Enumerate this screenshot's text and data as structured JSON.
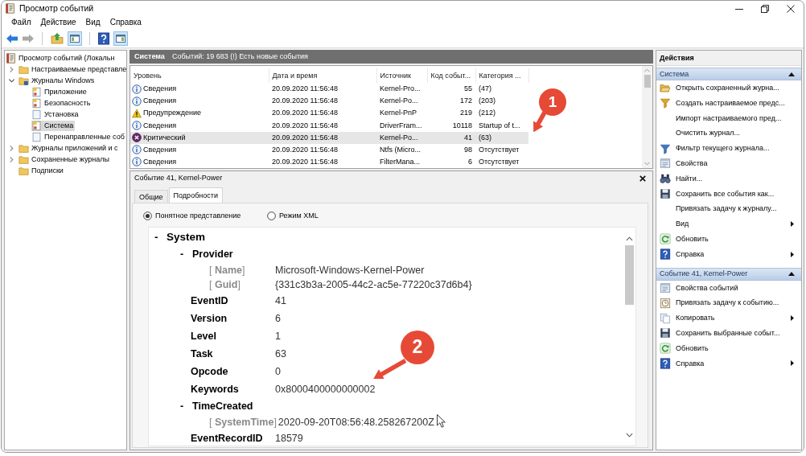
{
  "window": {
    "title": "Просмотр событий"
  },
  "menu": [
    "Файл",
    "Действие",
    "Вид",
    "Справка"
  ],
  "toolbar": [
    [
      {
        "kind": "back",
        "disabled": false
      },
      {
        "kind": "forward",
        "disabled": true
      }
    ],
    [
      {
        "kind": "up",
        "pressed": false
      },
      {
        "kind": "tree",
        "pressed": true
      }
    ],
    [
      {
        "kind": "help",
        "pressed": false
      },
      {
        "kind": "pane",
        "pressed": true
      }
    ]
  ],
  "tree": [
    {
      "label": "Просмотр событий (Локальн",
      "kind": "root",
      "selected": false,
      "children": [
        {
          "label": "Настраиваемые представле",
          "kind": "folder",
          "expanded": false,
          "selected": false
        },
        {
          "label": "Журналы Windows",
          "kind": "winfolder",
          "expanded": true,
          "selected": false,
          "children": [
            {
              "label": "Приложение",
              "kind": "log",
              "selected": false
            },
            {
              "label": "Безопасность",
              "kind": "log",
              "selected": false
            },
            {
              "label": "Установка",
              "kind": "blanklog",
              "selected": false
            },
            {
              "label": "Система",
              "kind": "log",
              "selected": true
            },
            {
              "label": "Перенаправленные соб",
              "kind": "blanklog",
              "selected": false
            }
          ]
        },
        {
          "label": "Журналы приложений и с",
          "kind": "folder",
          "expanded": false,
          "selected": false
        },
        {
          "label": "Сохраненные журналы",
          "kind": "folder",
          "expanded": false,
          "selected": false
        },
        {
          "label": "Подписки",
          "kind": "folder",
          "selected": false
        }
      ]
    }
  ],
  "log": {
    "title": "Система",
    "summary": "Событий: 19 683 (!) Есть новые события"
  },
  "table": {
    "columns": [
      "Уровень",
      "Дата и время",
      "Источник",
      "Код событ...",
      "Категория ..."
    ],
    "rows": [
      {
        "kind": "info",
        "selected": false,
        "cells": [
          "Сведения",
          "20.09.2020 11:56:48",
          "Kernel-Pro...",
          "55",
          "(47)"
        ]
      },
      {
        "kind": "info",
        "selected": false,
        "cells": [
          "Сведения",
          "20.09.2020 11:56:48",
          "Kernel-Po...",
          "172",
          "(203)"
        ]
      },
      {
        "kind": "warning",
        "selected": false,
        "cells": [
          "Предупреждение",
          "20.09.2020 11:56:48",
          "Kernel-PnP",
          "219",
          "(212)"
        ]
      },
      {
        "kind": "info",
        "selected": false,
        "cells": [
          "Сведения",
          "20.09.2020 11:56:48",
          "DriverFram...",
          "10118",
          "Startup of t..."
        ]
      },
      {
        "kind": "critical",
        "selected": true,
        "cells": [
          "Критический",
          "20.09.2020 11:56:48",
          "Kernel-Po...",
          "41",
          "(63)"
        ]
      },
      {
        "kind": "info",
        "selected": false,
        "cells": [
          "Сведения",
          "20.09.2020 11:56:48",
          "Ntfs (Micro...",
          "98",
          "Отсутствует"
        ]
      },
      {
        "kind": "info",
        "selected": false,
        "cells": [
          "Сведения",
          "20.09.2020 11:56:48",
          "FilterMana...",
          "6",
          "Отсутствует"
        ]
      }
    ]
  },
  "details": {
    "title": "Событие 41, Kernel-Power",
    "tabs": [
      {
        "label": "Общие",
        "selected": false
      },
      {
        "label": "Подробности",
        "selected": true
      }
    ],
    "view_modes": [
      {
        "label": "Понятное представление",
        "selected": true
      },
      {
        "label": "Режим XML",
        "selected": false
      }
    ],
    "tree": [
      {
        "kind": "section",
        "toggle": "-",
        "name": "System",
        "children": [
          {
            "kind": "section",
            "toggle": "-",
            "name": "Provider",
            "children": [
              {
                "kind": "attribute",
                "name": "[ **Name**]",
                "value": "Microsoft-Windows-Kernel-Power"
              },
              {
                "kind": "attribute",
                "name": "[ **Guid**]",
                "value": "{331c3b3a-2005-44c2-ac5e-77220c37d6b4}"
              }
            ]
          },
          {
            "kind": "field",
            "name": "EventID",
            "value": "41"
          },
          {
            "kind": "field",
            "name": "Version",
            "value": "6"
          },
          {
            "kind": "field",
            "name": "Level",
            "value": "1"
          },
          {
            "kind": "field",
            "name": "Task",
            "value": "63"
          },
          {
            "kind": "field",
            "name": "Opcode",
            "value": "0"
          },
          {
            "kind": "field",
            "name": "Keywords",
            "value": "0x8000400000000002"
          },
          {
            "kind": "section",
            "toggle": "-",
            "name": "TimeCreated",
            "children": [
              {
                "kind": "attribute",
                "name": "[ **SystemTime**]",
                "value": "2020-09-20T08:56:48.258267200Z"
              }
            ]
          },
          {
            "kind": "field",
            "name": "EventRecordID",
            "value": "18579"
          }
        ]
      }
    ]
  },
  "actions": {
    "title": "Действия",
    "sections": [
      {
        "title": "Система",
        "expanded": true,
        "items": [
          {
            "kind": "open",
            "label": "Открыть сохраненный журна...",
            "submenu": false
          },
          {
            "kind": "newfilter",
            "label": "Создать настраиваемое предс...",
            "submenu": false
          },
          {
            "kind": "plain",
            "label": "Импорт настраиваемого пред...",
            "submenu": false
          },
          {
            "kind": "plain",
            "label": "Очистить журнал...",
            "submenu": false
          },
          {
            "kind": "filter",
            "label": "Фильтр текущего журнала...",
            "submenu": false
          },
          {
            "kind": "properties",
            "label": "Свойства",
            "submenu": false
          },
          {
            "kind": "find",
            "label": "Найти...",
            "submenu": false
          },
          {
            "kind": "save",
            "label": "Сохранить все события как...",
            "submenu": false
          },
          {
            "kind": "plain",
            "label": "Привязать задачу к журналу...",
            "submenu": false
          },
          {
            "kind": "plain",
            "label": "Вид",
            "submenu": true
          },
          {
            "kind": "refresh",
            "label": "Обновить",
            "submenu": false
          },
          {
            "kind": "help",
            "label": "Справка",
            "submenu": true
          }
        ]
      },
      {
        "title": "Событие 41, Kernel-Power",
        "expanded": true,
        "items": [
          {
            "kind": "properties",
            "label": "Свойства событий",
            "submenu": false
          },
          {
            "kind": "attach",
            "label": "Привязать задачу к событию...",
            "submenu": false
          },
          {
            "kind": "copy",
            "label": "Копировать",
            "submenu": true
          },
          {
            "kind": "save",
            "label": "Сохранить выбранные событ...",
            "submenu": false
          },
          {
            "kind": "refresh",
            "label": "Обновить",
            "submenu": false
          },
          {
            "kind": "help",
            "label": "Справка",
            "submenu": true
          }
        ]
      }
    ]
  },
  "annotations": [
    {
      "label": "1"
    },
    {
      "label": "2"
    }
  ]
}
